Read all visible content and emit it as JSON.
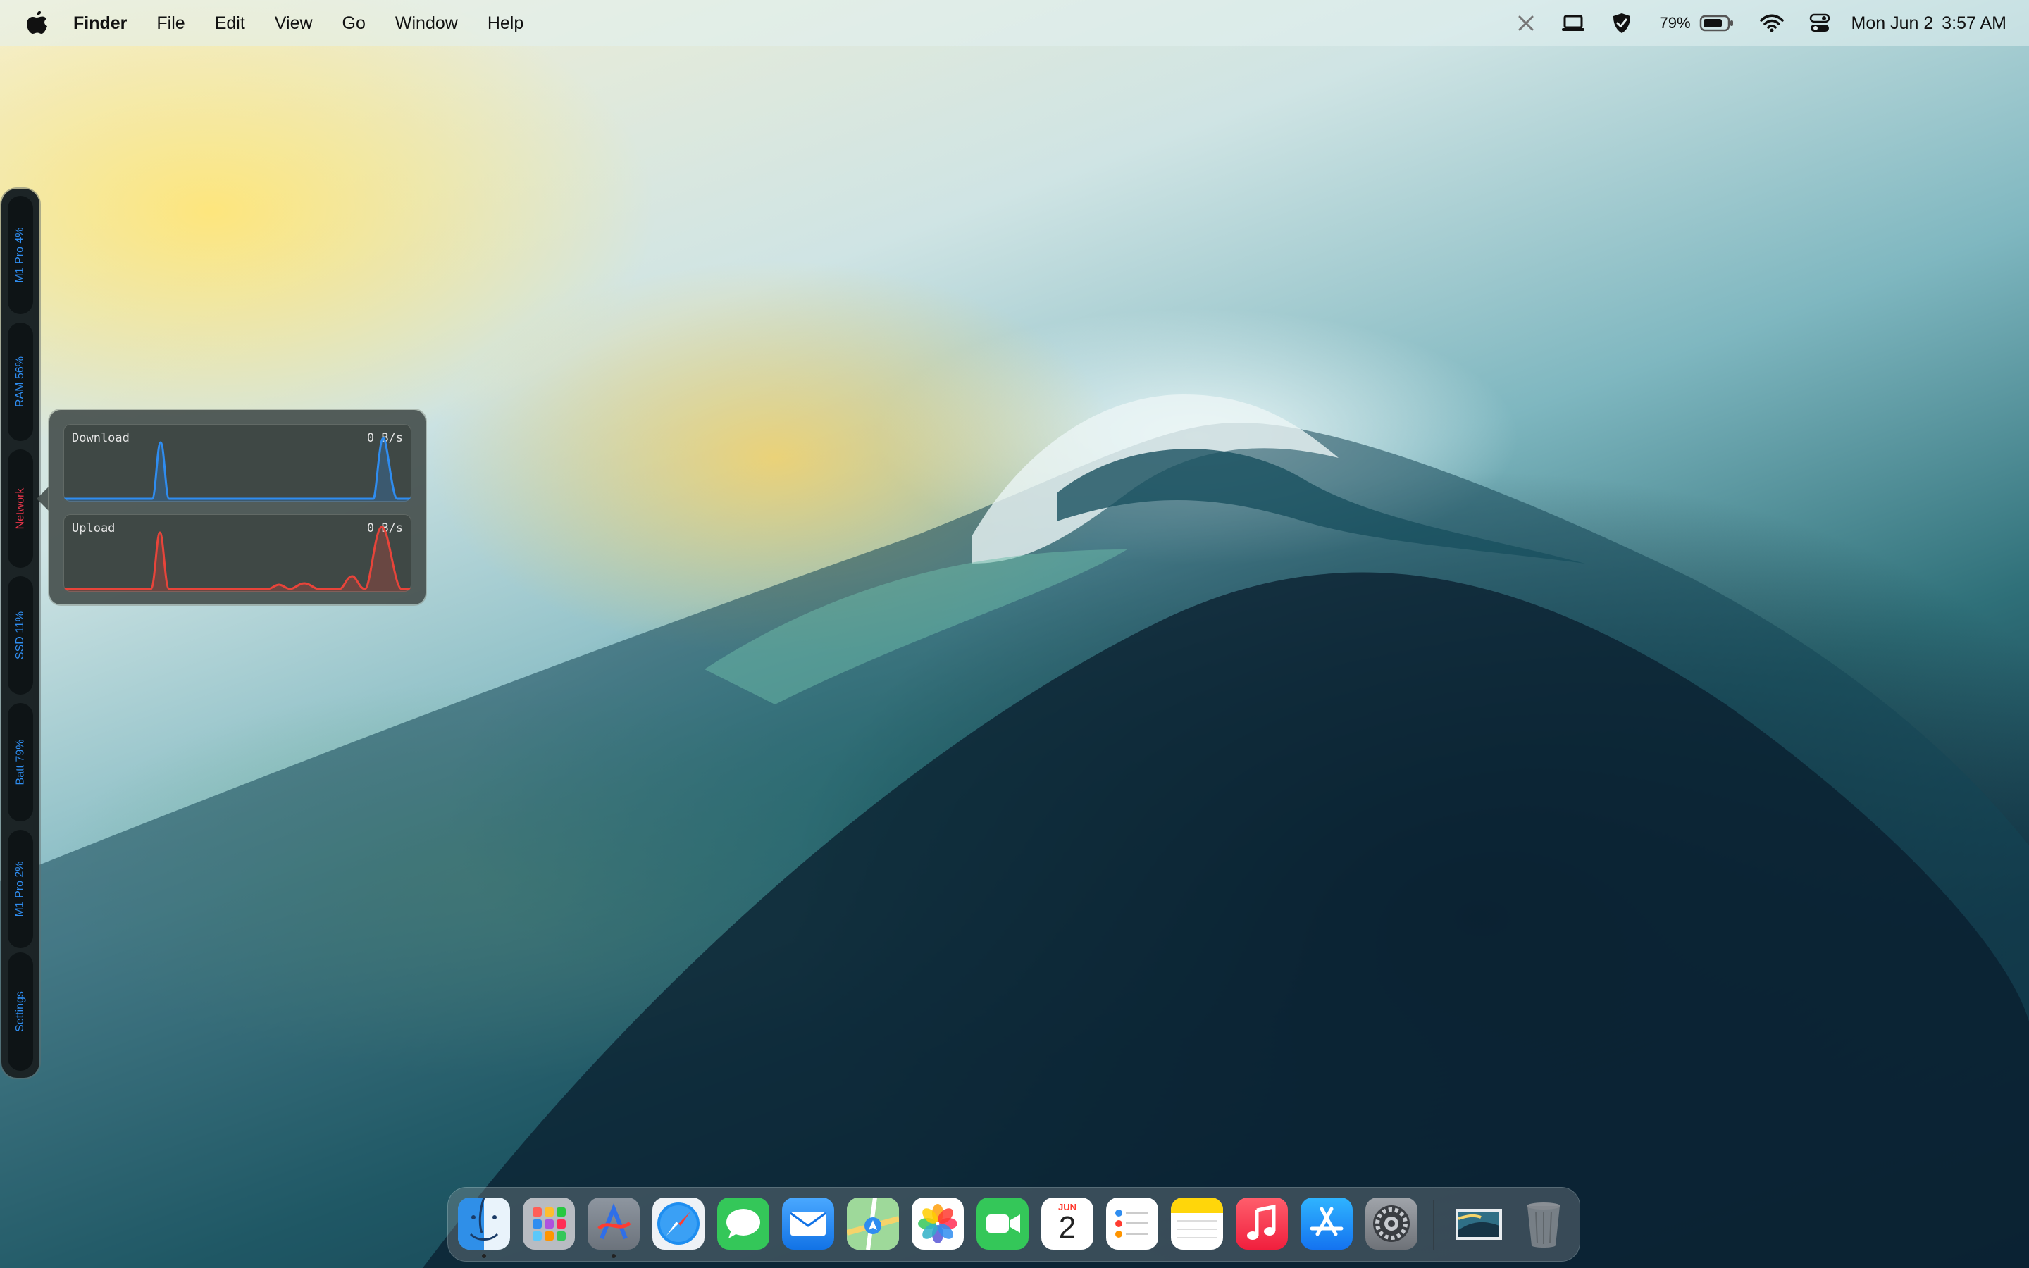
{
  "menubar": {
    "app_name": "Finder",
    "menus": [
      "File",
      "Edit",
      "View",
      "Go",
      "Window",
      "Help"
    ],
    "battery_percent": "79%",
    "date": "Mon Jun 2",
    "time": "3:57 AM",
    "status_icons": [
      "close-x-icon",
      "laptop-icon",
      "shield-check-icon",
      "battery-icon",
      "wifi-icon",
      "control-center-icon"
    ]
  },
  "sidebar": {
    "items": [
      {
        "label": "M1 Pro 4%"
      },
      {
        "label": "RAM 56%"
      },
      {
        "label": "Network"
      },
      {
        "label": "SSD 11%"
      },
      {
        "label": "Batt 79%"
      },
      {
        "label": "M1 Pro 2%"
      },
      {
        "label": "Settings"
      }
    ],
    "active": "Network",
    "accent": "#2f8df0",
    "active_color": "#e8354a"
  },
  "network": {
    "download": {
      "label": "Download",
      "rate": "0 B/s",
      "color": "#2f8df0"
    },
    "upload": {
      "label": "Upload",
      "rate": "0 B/s",
      "color": "#e8443a"
    }
  },
  "dock": {
    "apps": [
      "finder-icon",
      "launchpad-icon",
      "instruments-icon",
      "safari-icon",
      "messages-icon",
      "mail-icon",
      "maps-icon",
      "photos-icon",
      "facetime-icon",
      "calendar-icon",
      "reminders-icon",
      "notes-icon",
      "music-icon",
      "app-store-icon",
      "system-settings-icon",
      "preview-image-icon",
      "trash-icon"
    ],
    "calendar": {
      "month": "JUN",
      "day": "2"
    }
  }
}
